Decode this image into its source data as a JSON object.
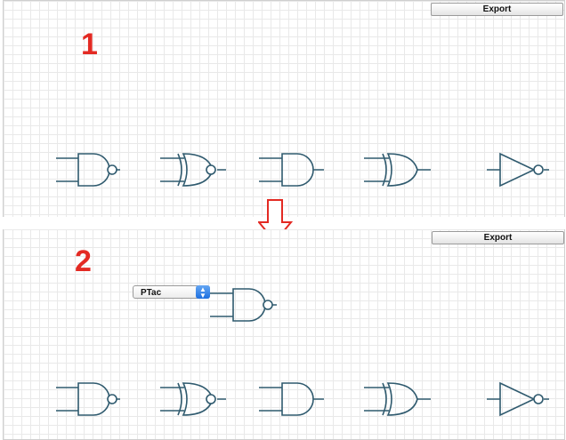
{
  "panels": [
    {
      "step": "1",
      "export_label": "Export"
    },
    {
      "step": "2",
      "export_label": "Export",
      "select_value": "PTac"
    }
  ],
  "gates_row": [
    "nand-gate",
    "xnor-gate",
    "and-gate",
    "xor-gate",
    "not-gate"
  ],
  "colors": {
    "gate": "#2f5a6e",
    "step_number": "#e32a23",
    "arrow": "#e32a23",
    "select_accent": "#1d6fe0",
    "grid": "#e9e9e9"
  },
  "icons": {
    "select_arrows": "up-down-chevron-icon",
    "transition": "down-arrow-icon"
  }
}
